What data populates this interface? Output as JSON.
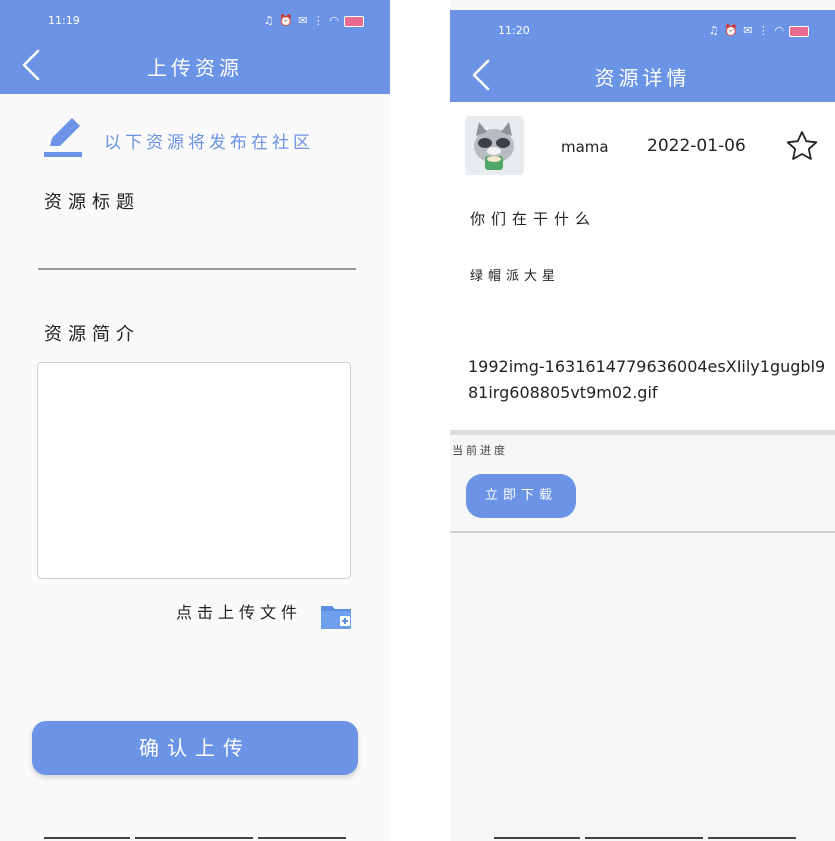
{
  "left": {
    "status": {
      "time": "11:19",
      "system": "♫ ⏰ ✉ ⋮ ◠"
    },
    "title": "上传资源",
    "hint": "以下资源将发布在社区",
    "title_label": "资源标题",
    "title_value": "",
    "intro_label": "资源简介",
    "intro_value": "",
    "upload_text": "点击上传文件",
    "confirm_label": "确认上传"
  },
  "right": {
    "status": {
      "time": "11:20",
      "system": "♫ ⏰ ✉ ⋮ ◠"
    },
    "title": "资源详情",
    "username": "mama",
    "date": "2022-01-06",
    "line1": "你们在干什么",
    "line2": "绿帽派大星",
    "filename": "1992img-1631614779636004esXIily1gugbl981irg608805vt9m02.gif",
    "progress_label": "当前进度",
    "download_label": "立即下载"
  },
  "colors": {
    "accent": "#6b93e6",
    "background": "#fafafa"
  },
  "icons": [
    "back-arrow-icon",
    "pencil-icon",
    "folder-add-icon",
    "star-outline-icon"
  ]
}
